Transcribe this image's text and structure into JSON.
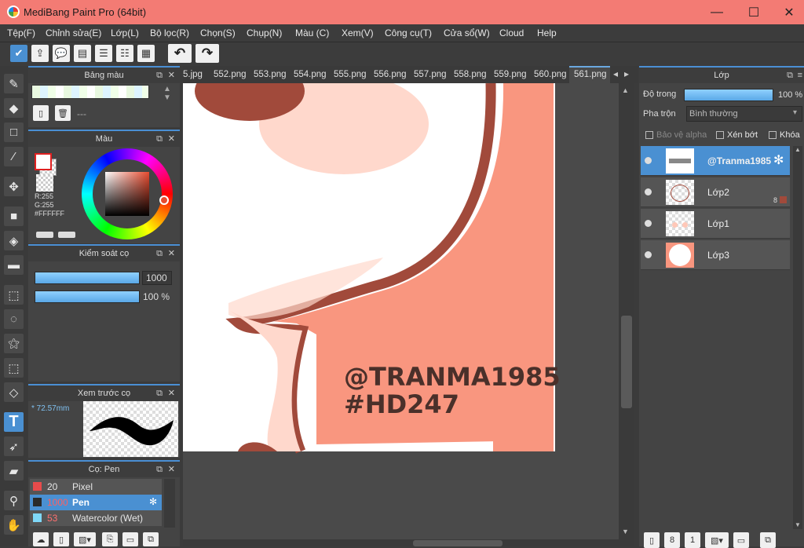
{
  "app": {
    "title": "MediBang Paint Pro (64bit)",
    "minimize": "—",
    "maximize": "☐",
    "close": "✕"
  },
  "menu": [
    "Tệp(F)",
    "Chỉnh sửa(E)",
    "Lớp(L)",
    "Bộ lọc(R)",
    "Chọn(S)",
    "Chụp(N)",
    "Màu (C)",
    "Xem(V)",
    "Công cụ(T)",
    "Cửa sổ(W)",
    "Cloud",
    "Help"
  ],
  "toolbar": {
    "undo": "↶",
    "redo": "↷"
  },
  "tabs": [
    "5.jpg",
    "552.png",
    "553.png",
    "554.png",
    "555.png",
    "556.png",
    "557.png",
    "558.png",
    "559.png",
    "560.png",
    "561.png"
  ],
  "palette": {
    "title": "Bảng màu",
    "placeholder": "---"
  },
  "color": {
    "title": "Màu",
    "r": "R:255",
    "g": "G:255",
    "hex": "#FFFFFF",
    "wheel_marker": "#e84b2f"
  },
  "brush_control": {
    "title": "Kiểm soát cọ",
    "size": "1000",
    "opacity": "100 %"
  },
  "brush_preview": {
    "title": "Xem trước cọ",
    "size": "* 72.57mm"
  },
  "brush_list": {
    "title": "Cọ: Pen",
    "items": [
      {
        "size": "20",
        "name": "Pixel",
        "color": "#e84b4b"
      },
      {
        "size": "1000",
        "name": "Pen",
        "color": "#2a2a2a"
      },
      {
        "size": "53",
        "name": "Watercolor (Wet)",
        "color": "#7fd8f8"
      }
    ]
  },
  "canvas": {
    "line1": "@TRANMA1985",
    "line2": "#HD247"
  },
  "layers": {
    "title": "Lớp",
    "opacity_label": "Độ trong",
    "opacity_value": "100 %",
    "opacity": 1.0,
    "blend_label": "Pha trộn",
    "blend_value": "Bình thường",
    "protect_alpha": "Bảo vệ alpha",
    "clipping": "Xén bớt",
    "lock": "Khóa",
    "items": [
      {
        "name": "@Tranma1985"
      },
      {
        "name": "Lớp2",
        "badge": "8"
      },
      {
        "name": "Lớp1"
      },
      {
        "name": "Lớp3"
      }
    ]
  }
}
